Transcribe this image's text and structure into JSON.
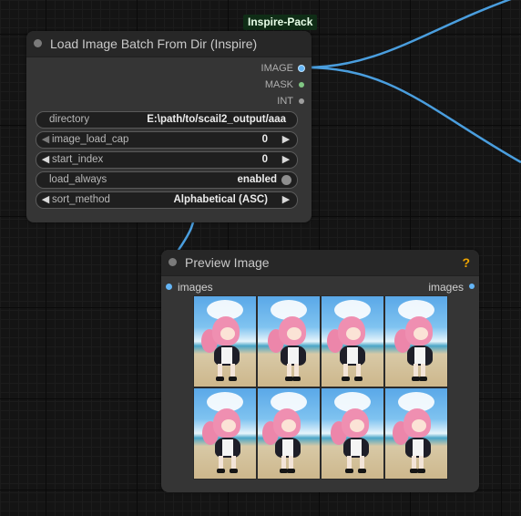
{
  "colors": {
    "link": "#4a9ede",
    "image_port": "#64b5f6",
    "mask_port": "#81c784",
    "int_port": "#9e9e9e",
    "help": "#f0a500",
    "badge_bg": "#0f2d16"
  },
  "badge": {
    "label": "Inspire-Pack"
  },
  "load_node": {
    "title": "Load Image Batch From Dir (Inspire)",
    "outputs": [
      {
        "label": "IMAGE",
        "port_color": "#64b5f6"
      },
      {
        "label": "MASK",
        "port_color": "#81c784"
      },
      {
        "label": "INT",
        "port_color": "#9e9e9e"
      }
    ],
    "widgets": {
      "directory": {
        "label": "directory",
        "value": "E:\\path/to/scail2_output/aaa"
      },
      "image_load_cap": {
        "label": "image_load_cap",
        "value": "0"
      },
      "start_index": {
        "label": "start_index",
        "value": "0"
      },
      "load_always": {
        "label": "load_always",
        "value": "enabled"
      },
      "sort_method": {
        "label": "sort_method",
        "value": "Alphabetical (ASC)"
      }
    },
    "arrow_left": "◀",
    "arrow_right": "▶"
  },
  "preview_node": {
    "title": "Preview Image",
    "help": "?",
    "input_label": "images",
    "output_label": "images",
    "images": [
      "frame-1",
      "frame-2",
      "frame-3",
      "frame-4",
      "frame-5",
      "frame-6",
      "frame-7",
      "frame-8"
    ]
  }
}
